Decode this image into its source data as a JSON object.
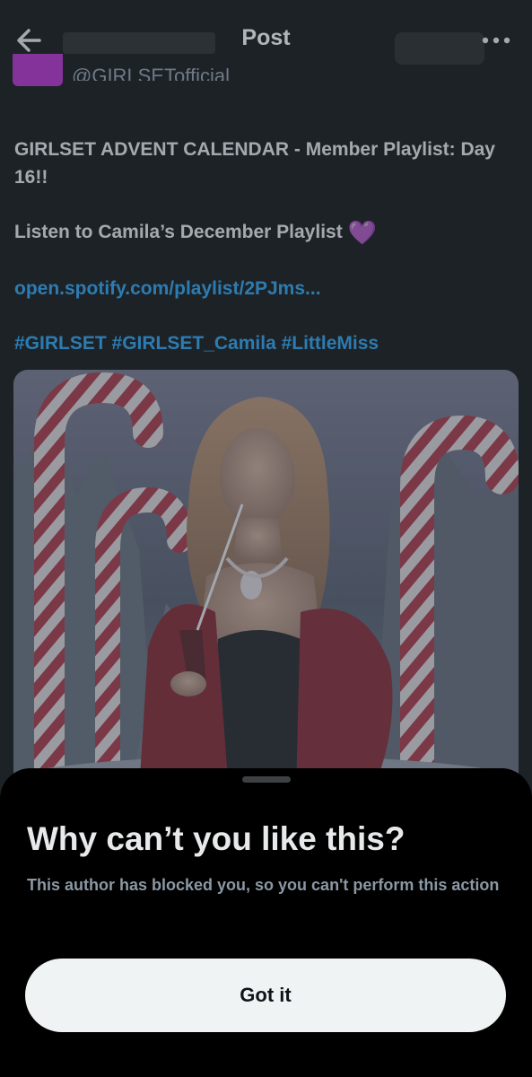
{
  "header": {
    "title": "Post",
    "handle": "@GIRLSETofficial"
  },
  "post": {
    "line1": "GIRLSET ADVENT CALENDAR - Member Playlist: Day 16!!",
    "line2": "Listen to Camila’s December Playlist",
    "heart": "💜",
    "link": "open.spotify.com/playlist/2PJms...",
    "hashtags": "#GIRLSET #GIRLSET_Camila #LittleMiss"
  },
  "sheet": {
    "title": "Why can’t you like this?",
    "body": "This author has blocked you, so you can't perform this action",
    "button_label": "Got it"
  },
  "colors": {
    "link": "#1d9bf0",
    "sheet_bg": "#000000",
    "button_bg": "#eff3f4"
  }
}
